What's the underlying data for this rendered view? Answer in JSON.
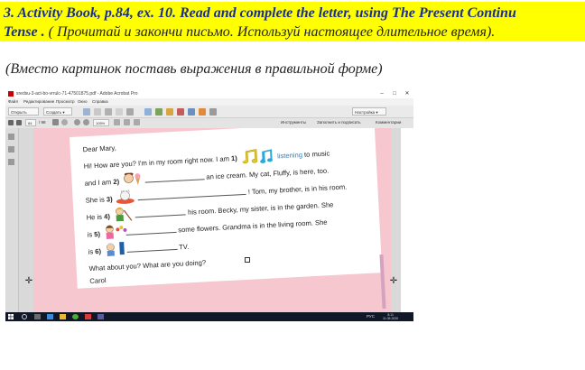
{
  "instruction": {
    "line1": "3. Activity Book, p.84, ex. 10. Read and complete the letter, using The Present Continu",
    "line2_bold": "Tense .",
    "line2_rest": " ( Прочитай и закончи письмо. Используй настоящее длительное время).",
    "line3": "(Вместо картинок поставь  выражения в правильной форме)"
  },
  "window": {
    "title": "sredsu-3-act-bo-vrrulc-71-47501875.pdf - Adobe Acrobat Pro",
    "menu": [
      "Файл",
      "Редактирование",
      "Просмотр",
      "Окно",
      "Справка"
    ],
    "toolbar": {
      "open_label": "Открыть",
      "create_label": "Создать",
      "settings_label": "Настройка"
    },
    "nav": {
      "page_current": "84",
      "page_total": "/ 98",
      "zoom": "105%"
    },
    "tabs": [
      "Инструменты",
      "Заполнить и подписать",
      "Комментарии"
    ]
  },
  "letter": {
    "greeting": "Dear Mary,",
    "l1a": "Hi! How are you? I'm in my room right now. I am",
    "l1n": "1)",
    "l1ans": "listening",
    "l1b": "to music",
    "l2a": "and I am",
    "l2n": "2)",
    "l2b": "an ice cream. My cat, Fluffy, is here, too.",
    "l3a": "She is",
    "l3n": "3)",
    "l3b": "! Tom, my brother, is in his room.",
    "l4a": "He is",
    "l4n": "4)",
    "l4b": "his room. Becky, my sister, is in the garden. She",
    "l5a": "is",
    "l5n": "5)",
    "l5b": "some flowers. Grandma is in the living room. She",
    "l6a": "is",
    "l6n": "6)",
    "l6b": "TV.",
    "l7": "What about you? What are you doing?",
    "sign": "Carol"
  },
  "taskbar": {
    "lang": "РУС",
    "time": "8:11",
    "date": "11.05.2020"
  },
  "colors": {
    "instruction_bg": "#ffff00",
    "instruction_text": "#1a2e8f",
    "answer_blue": "#1e88c8",
    "page_pink": "#f6c7cf",
    "page_red": "#d6252b"
  }
}
